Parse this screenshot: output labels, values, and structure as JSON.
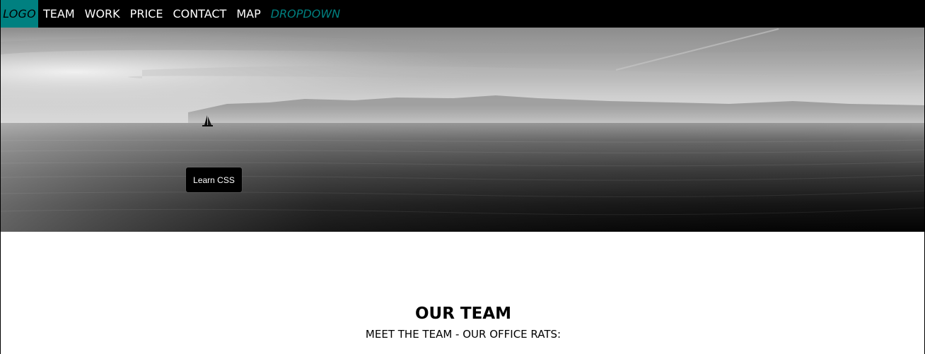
{
  "nav": {
    "logo": "LOGO",
    "items": [
      {
        "label": "TEAM"
      },
      {
        "label": "WORK"
      },
      {
        "label": "PRICE"
      },
      {
        "label": "CONTACT"
      },
      {
        "label": "MAP"
      }
    ],
    "dropdown": "DROPDOWN"
  },
  "hero": {
    "button_label": "Learn CSS"
  },
  "team": {
    "title": "OUR TEAM",
    "subtitle": "MEET THE TEAM - OUR OFFICE RATS:"
  },
  "colors": {
    "accent": "#008080",
    "nav_background": "#000000",
    "nav_text": "#ffffff",
    "page_background": "#ffffff"
  }
}
